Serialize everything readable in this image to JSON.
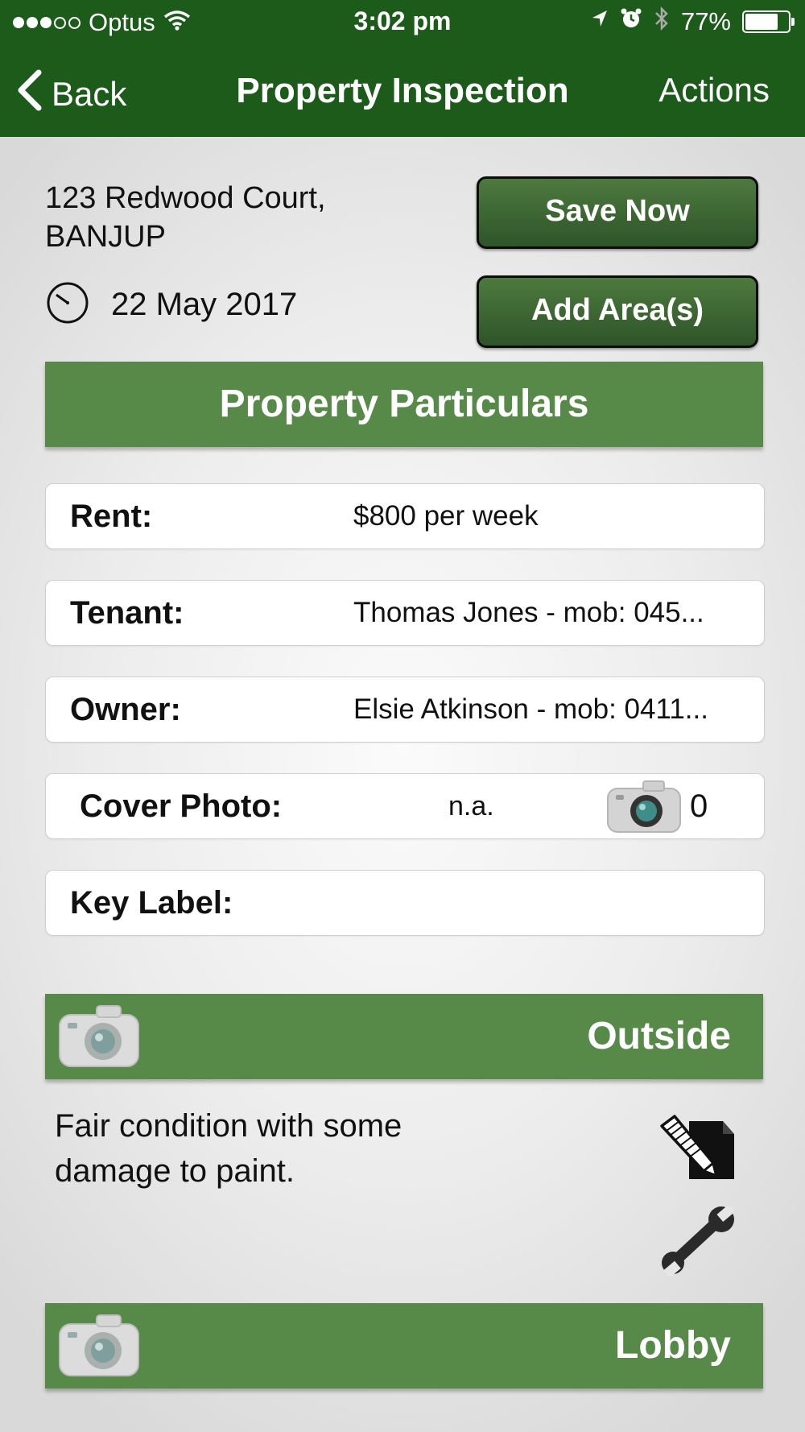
{
  "status_bar": {
    "carrier": "Optus",
    "signal_bars": 3,
    "time": "3:02 pm",
    "battery": "77%"
  },
  "nav": {
    "back_label": "Back",
    "title": "Property Inspection",
    "actions_label": "Actions"
  },
  "property": {
    "address_line1": "123 Redwood Court,",
    "address_line2": "BANJUP",
    "date": "22 May 2017"
  },
  "buttons": {
    "save": "Save Now",
    "add_area": "Add Area(s)"
  },
  "particulars": {
    "header": "Property Particulars",
    "fields": [
      {
        "label": "Rent:",
        "value": "$800 per week"
      },
      {
        "label": "Tenant:",
        "value": "Thomas Jones - mob: 045..."
      },
      {
        "label": "Owner:",
        "value": "Elsie Atkinson - mob: 0411..."
      },
      {
        "label": "Cover Photo:",
        "value": "n.a.",
        "photo_count": "0"
      },
      {
        "label": "Key Label:",
        "value": ""
      }
    ]
  },
  "areas": [
    {
      "name": "Outside",
      "description_line1": "Fair condition with some",
      "description_line2": "damage to paint."
    },
    {
      "name": "Lobby"
    }
  ],
  "colors": {
    "nav_bar": "#1d5b1b",
    "section_header": "#578a48",
    "button_bg": "#3d6a32"
  },
  "icons": [
    "camera-icon",
    "clock-icon",
    "edit-icon",
    "wrench-icon",
    "chevron-left-icon",
    "wifi-icon",
    "location-icon",
    "alarm-icon",
    "bluetooth-icon",
    "battery-icon"
  ]
}
